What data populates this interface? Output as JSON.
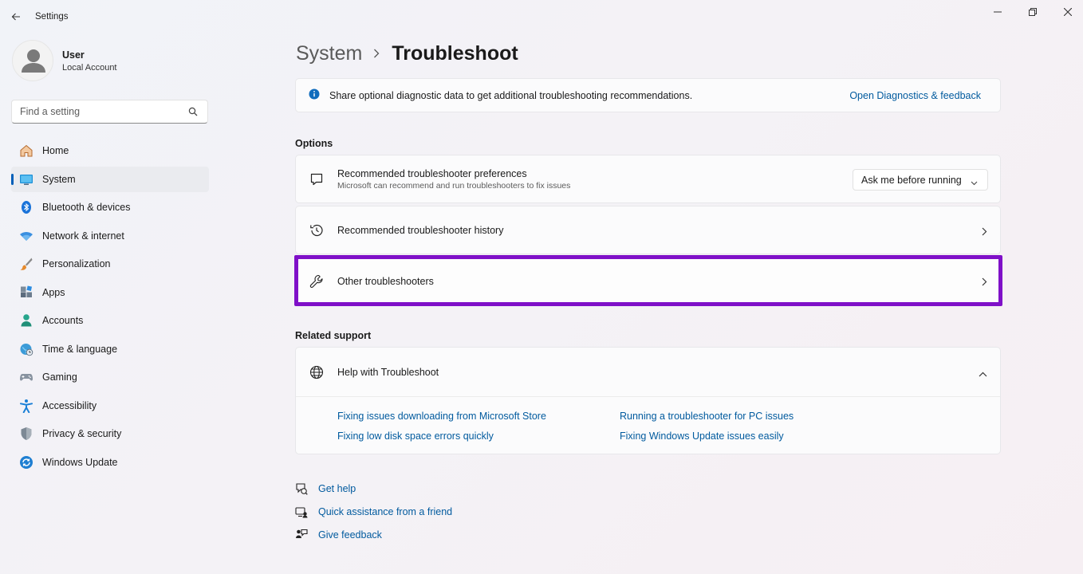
{
  "window": {
    "title": "Settings"
  },
  "profile": {
    "name": "User",
    "account_type": "Local Account"
  },
  "search": {
    "placeholder": "Find a setting"
  },
  "sidebar": {
    "items": [
      {
        "label": "Home",
        "icon": "home-icon",
        "active": false
      },
      {
        "label": "System",
        "icon": "system-icon",
        "active": true
      },
      {
        "label": "Bluetooth & devices",
        "icon": "bluetooth-icon",
        "active": false
      },
      {
        "label": "Network & internet",
        "icon": "wifi-icon",
        "active": false
      },
      {
        "label": "Personalization",
        "icon": "brush-icon",
        "active": false
      },
      {
        "label": "Apps",
        "icon": "apps-icon",
        "active": false
      },
      {
        "label": "Accounts",
        "icon": "accounts-icon",
        "active": false
      },
      {
        "label": "Time & language",
        "icon": "globe-clock-icon",
        "active": false
      },
      {
        "label": "Gaming",
        "icon": "gamepad-icon",
        "active": false
      },
      {
        "label": "Accessibility",
        "icon": "accessibility-icon",
        "active": false
      },
      {
        "label": "Privacy & security",
        "icon": "shield-icon",
        "active": false
      },
      {
        "label": "Windows Update",
        "icon": "update-icon",
        "active": false
      }
    ]
  },
  "breadcrumb": {
    "parent": "System",
    "current": "Troubleshoot"
  },
  "banner": {
    "text": "Share optional diagnostic data to get additional troubleshooting recommendations.",
    "link": "Open Diagnostics & feedback"
  },
  "options": {
    "title": "Options",
    "preferences": {
      "title": "Recommended troubleshooter preferences",
      "subtitle": "Microsoft can recommend and run troubleshooters to fix issues",
      "selected": "Ask me before running"
    },
    "history": {
      "title": "Recommended troubleshooter history"
    },
    "other": {
      "title": "Other troubleshooters"
    }
  },
  "related": {
    "title": "Related support",
    "help_title": "Help with Troubleshoot",
    "links": [
      "Fixing issues downloading from Microsoft Store",
      "Running a troubleshooter for PC issues",
      "Fixing low disk space errors quickly",
      "Fixing Windows Update issues easily"
    ]
  },
  "footer_links": {
    "get_help": "Get help",
    "quick_assist": "Quick assistance from a friend",
    "feedback": "Give feedback"
  },
  "colors": {
    "accent": "#005fb8",
    "link": "#005a9e",
    "highlight": "#7f10c8"
  }
}
